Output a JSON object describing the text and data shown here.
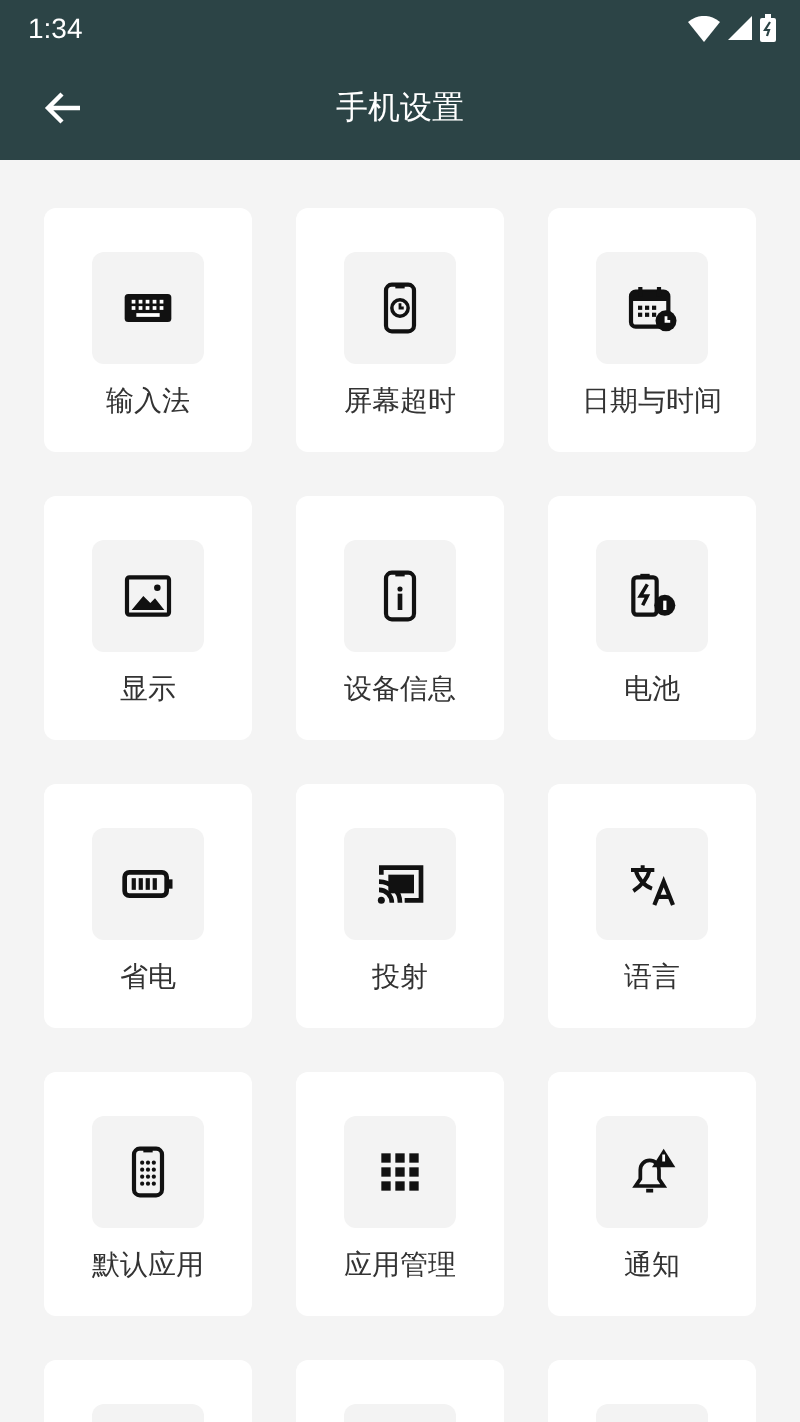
{
  "status_bar": {
    "time": "1:34"
  },
  "app_bar": {
    "title": "手机设置"
  },
  "items": [
    {
      "kind": "tile",
      "label": "输入法"
    },
    {
      "kind": "tile",
      "label": "屏幕超时"
    },
    {
      "kind": "tile",
      "label": "日期与时间"
    },
    {
      "kind": "tile",
      "label": "显示"
    },
    {
      "kind": "tile",
      "label": "设备信息"
    },
    {
      "kind": "tile",
      "label": "电池"
    },
    {
      "kind": "tile",
      "label": "省电"
    },
    {
      "kind": "tile",
      "label": "投射"
    },
    {
      "kind": "tile",
      "label": "语言"
    },
    {
      "kind": "tile",
      "label": "默认应用"
    },
    {
      "kind": "tile",
      "label": "应用管理"
    },
    {
      "kind": "tile",
      "label": "通知"
    },
    {
      "kind": "cut"
    },
    {
      "kind": "cut"
    },
    {
      "kind": "cut"
    }
  ]
}
